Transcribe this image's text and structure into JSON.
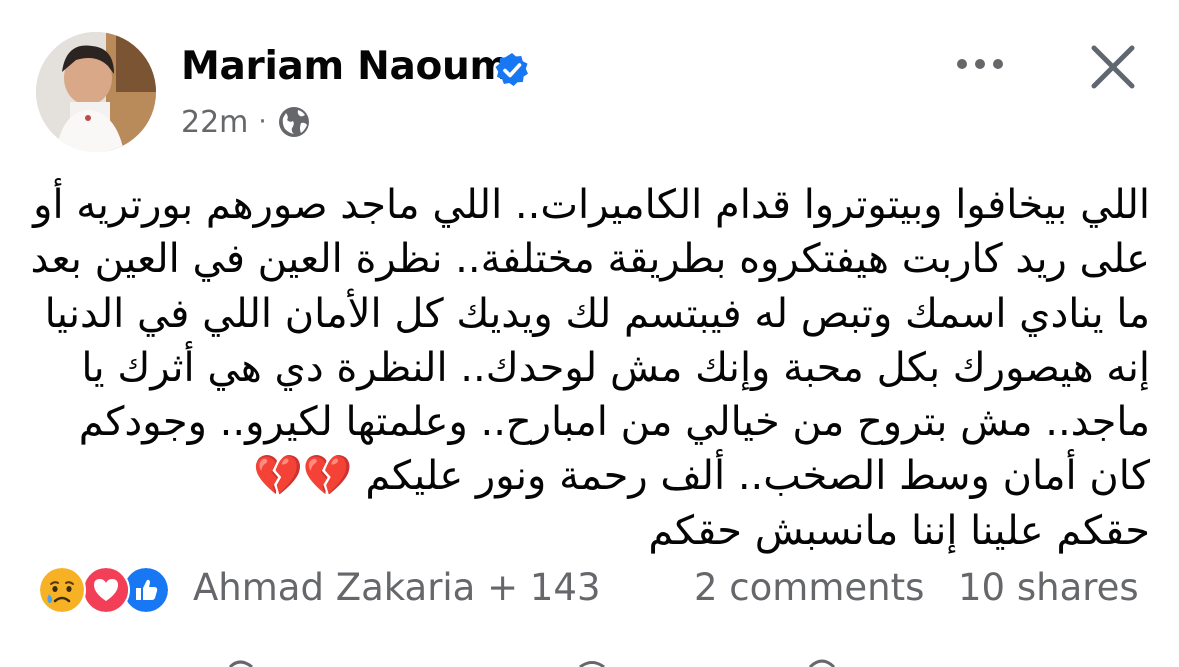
{
  "post": {
    "author": "Mariam Naoum",
    "time": "22m",
    "separator": "·",
    "lines": [
      "اللي بيخافوا وبيتوتروا قدام الكاميرات.. اللي ماجد صورهم بورتريه أو",
      "على ريد كاربت هيفتكروه بطريقة مختلفة.. نظرة العين في العين بعد",
      "ما ينادي اسمك وتبص له فيبتسم لك ويديك كل الأمان اللي في الدنيا",
      "إنه هيصورك بكل محبة وإنك مش لوحدك.. النظرة دي هي أثرك يا",
      "ماجد.. مش بتروح من خيالي من امبارح.. وعلمتها لكيرو.. وجودكم",
      "كان أمان وسط الصخب.. ألف رحمة ونور عليكم 💔💔",
      "حقكم علينا إننا مانسبش حقكم"
    ],
    "reactions_text": "Ahmad Zakaria + 143",
    "comments_text": "2 comments",
    "shares_text": "10 shares"
  },
  "icons": {
    "verified": "verified-badge-icon",
    "privacy": "globe-icon",
    "more": "more-dots-icon",
    "close": "close-icon",
    "reactions": [
      "sad-reaction-icon",
      "love-reaction-icon",
      "like-reaction-icon"
    ]
  },
  "colors": {
    "verified_blue": "#1877f2",
    "meta_gray": "#65676b",
    "text": "#050505",
    "love_red": "#f33e58",
    "sad_yellow": "#f7b125"
  }
}
